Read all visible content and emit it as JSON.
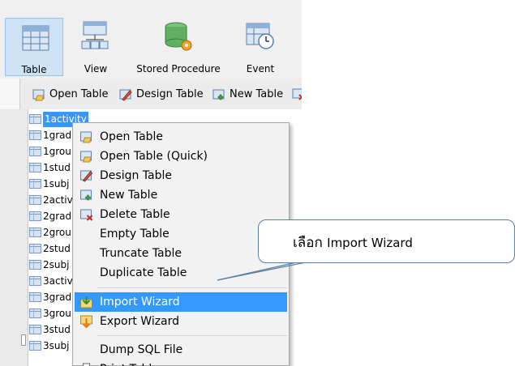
{
  "toolbar": {
    "buttons": [
      {
        "label": "Table",
        "icon": "table-icon",
        "active": true
      },
      {
        "label": "View",
        "icon": "view-icon"
      },
      {
        "label": "Stored Procedure",
        "icon": "stored-procedure-icon"
      },
      {
        "label": "Event",
        "icon": "event-icon"
      }
    ]
  },
  "subbar": {
    "open_table": "Open Table",
    "design_table": "Design Table",
    "new_table": "New Table"
  },
  "tables": [
    "1activity",
    "1grad",
    "1grou",
    "1stud",
    "1subj",
    "2activ",
    "2grad",
    "2grou",
    "2stud",
    "2subj",
    "3activ",
    "3grad",
    "3grou",
    "3stud",
    "3subj"
  ],
  "context_menu": {
    "items": [
      "Open Table",
      "Open Table (Quick)",
      "Design Table",
      "New Table",
      "Delete Table",
      "Empty Table",
      "Truncate Table",
      "Duplicate Table",
      "Import Wizard",
      "Export Wizard",
      "Dump SQL File",
      "Print Tables"
    ],
    "highlighted": "Import Wizard"
  },
  "callout": {
    "thai": "เลือก",
    "english": "Import Wizard"
  },
  "colors": {
    "highlight": "#3399ff",
    "callout_border": "#5b7fa7"
  }
}
